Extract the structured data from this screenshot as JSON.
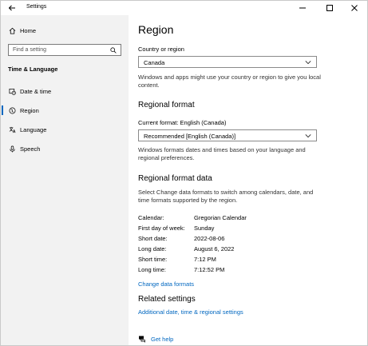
{
  "window": {
    "title": "Settings"
  },
  "sidebar": {
    "home_label": "Home",
    "search_placeholder": "Find a setting",
    "section_title": "Time & Language",
    "items": [
      {
        "label": "Date & time",
        "icon": "calendar-clock-icon"
      },
      {
        "label": "Region",
        "icon": "globe-region-icon",
        "active": true
      },
      {
        "label": "Language",
        "icon": "language-icon"
      },
      {
        "label": "Speech",
        "icon": "microphone-icon"
      }
    ]
  },
  "main": {
    "page_title": "Region",
    "country": {
      "label": "Country or region",
      "value": "Canada",
      "description": "Windows and apps might use your country or region to give you local content."
    },
    "regional_format": {
      "heading": "Regional format",
      "current_label": "Current format: English (Canada)",
      "value": "Recommended [English (Canada)]",
      "description": "Windows formats dates and times based on your language and regional preferences."
    },
    "format_data": {
      "heading": "Regional format data",
      "description": "Select Change data formats to switch among calendars, date, and time formats supported by the region.",
      "rows": [
        {
          "key": "Calendar:",
          "value": "Gregorian Calendar"
        },
        {
          "key": "First day of week:",
          "value": "Sunday"
        },
        {
          "key": "Short date:",
          "value": "2022-08-06"
        },
        {
          "key": "Long date:",
          "value": "August 6, 2022"
        },
        {
          "key": "Short time:",
          "value": "7:12 PM"
        },
        {
          "key": "Long time:",
          "value": "7:12:52 PM"
        }
      ],
      "change_link": "Change data formats"
    },
    "related": {
      "heading": "Related settings",
      "link": "Additional date, time & regional settings"
    },
    "help_label": "Get help"
  },
  "colors": {
    "accent": "#0067c0",
    "sidebar_bg": "#f2f2f2"
  }
}
